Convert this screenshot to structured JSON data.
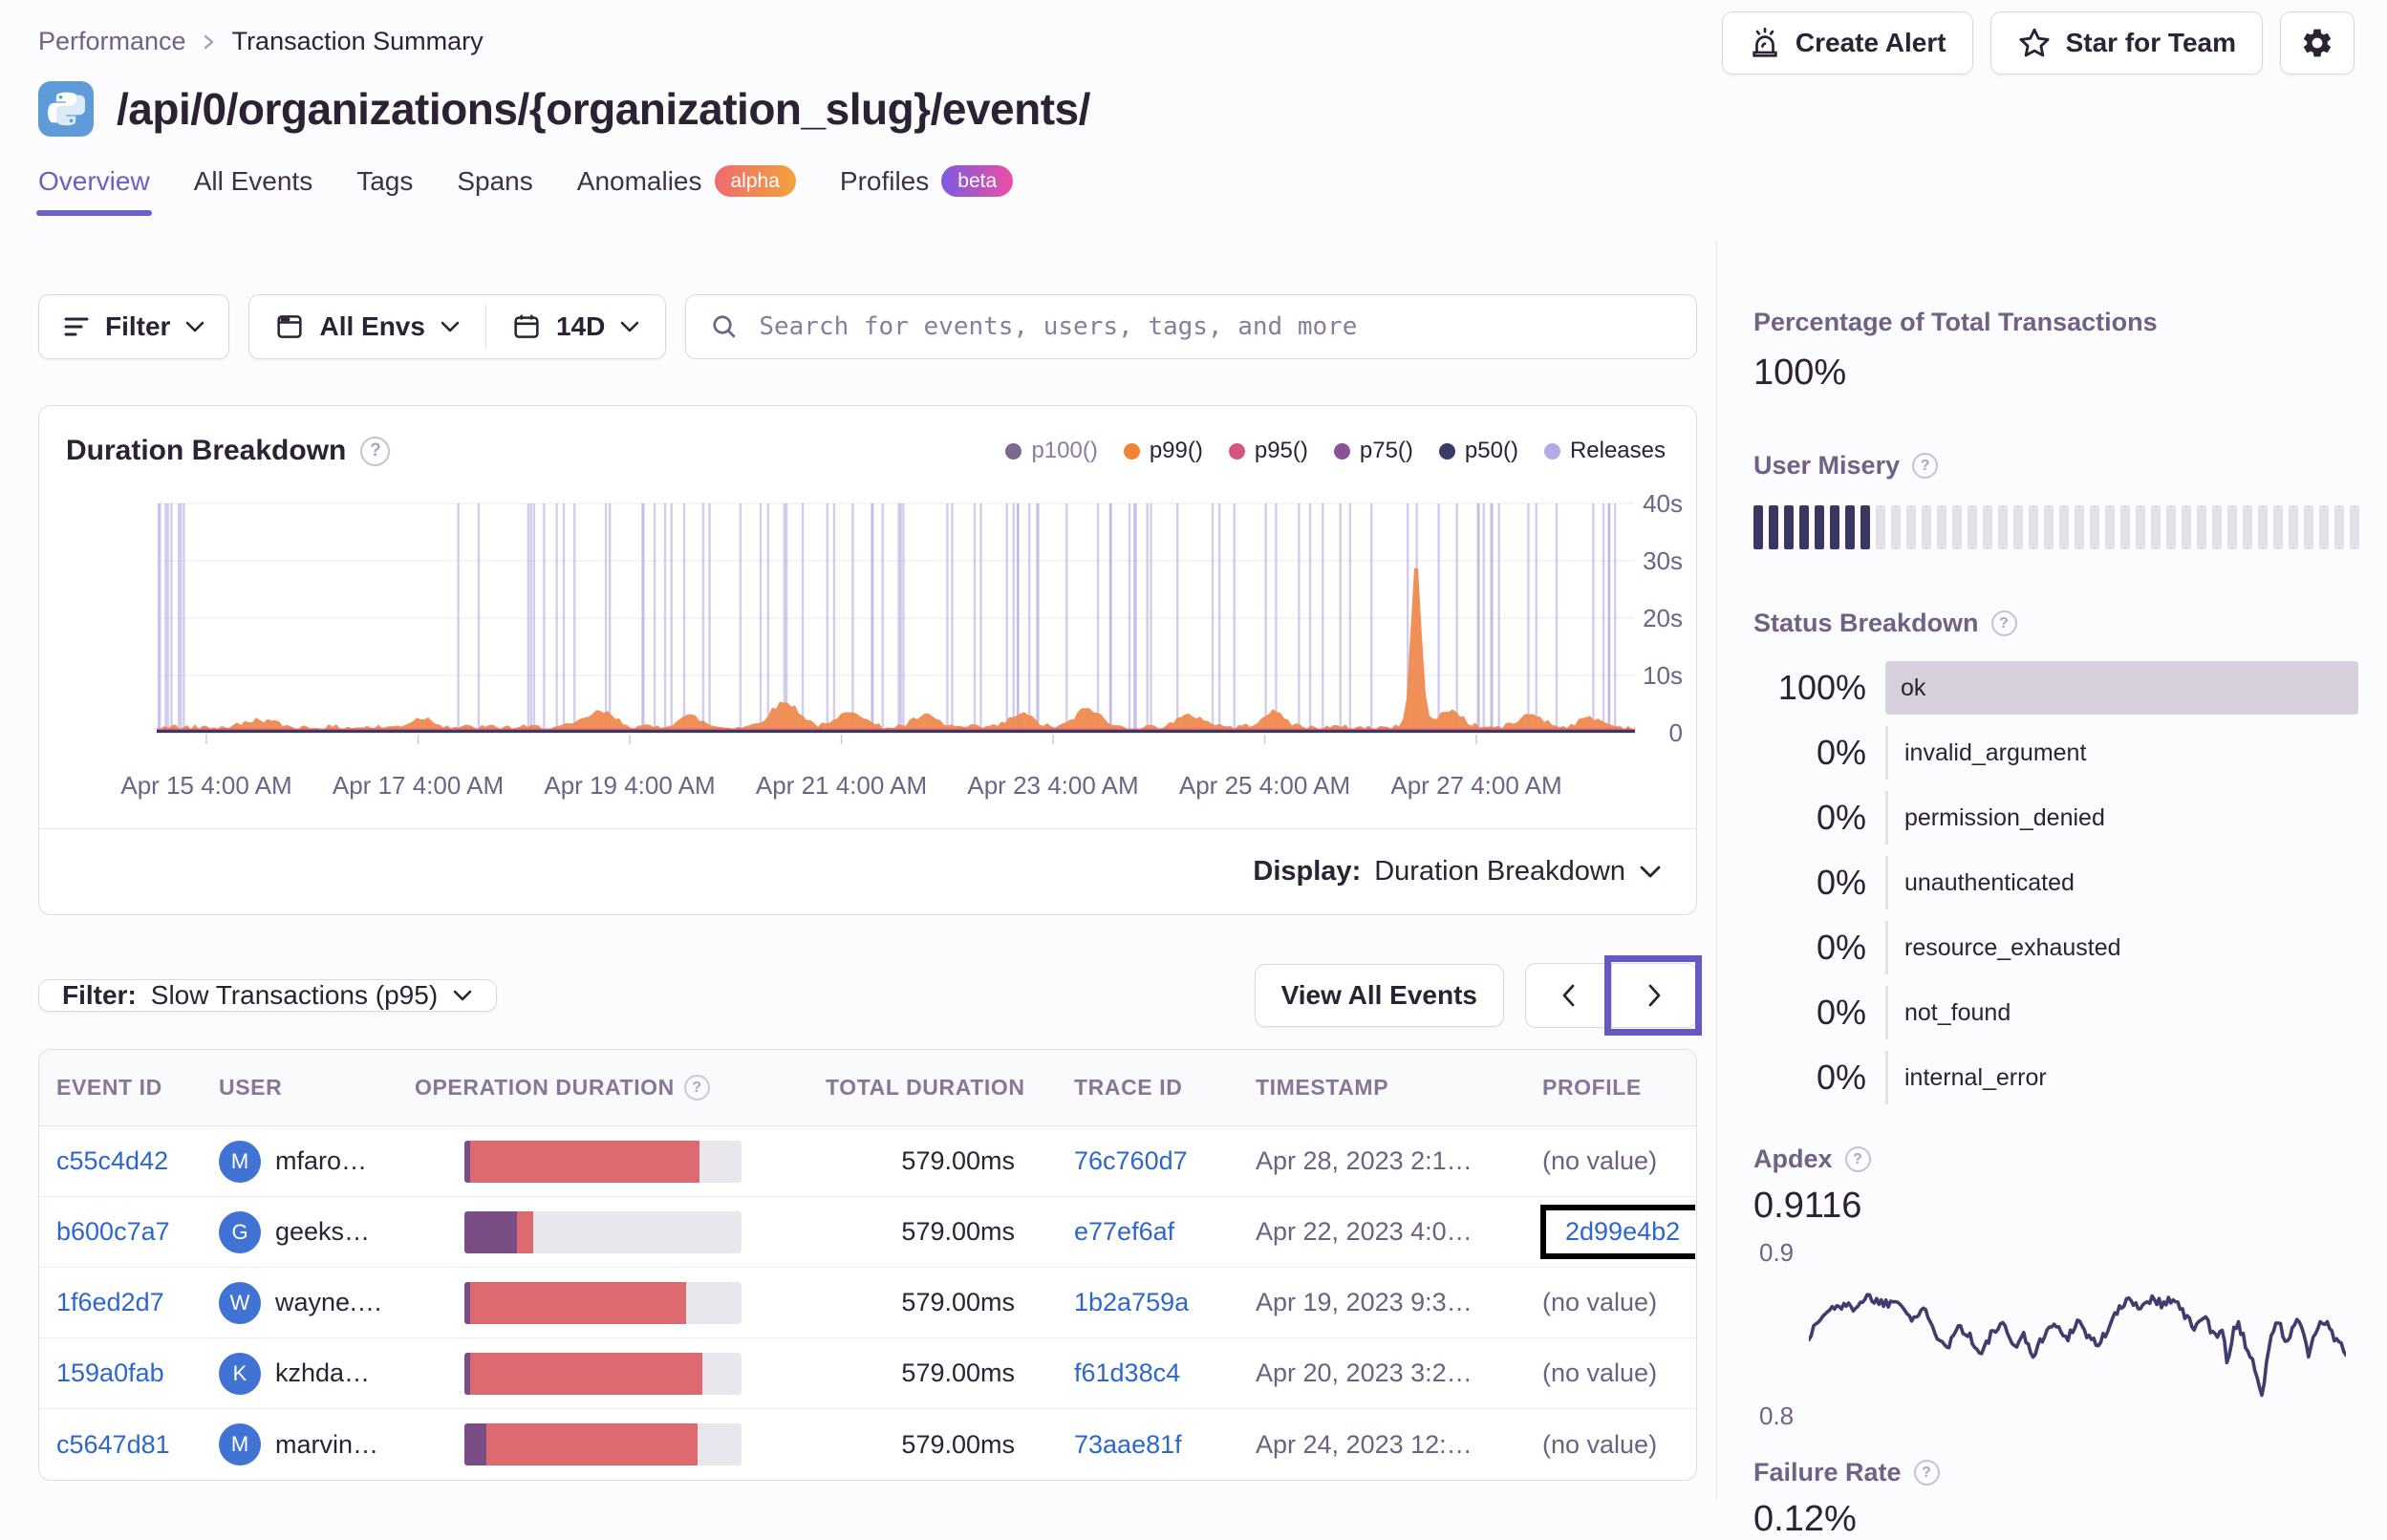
{
  "breadcrumb": {
    "parent": "Performance",
    "current": "Transaction Summary"
  },
  "header": {
    "title": "/api/0/organizations/{organization_slug}/events/",
    "language_icon": "python-icon",
    "create_alert_label": "Create Alert",
    "star_label": "Star for Team"
  },
  "tabs": [
    {
      "label": "Overview",
      "active": true
    },
    {
      "label": "All Events"
    },
    {
      "label": "Tags"
    },
    {
      "label": "Spans"
    },
    {
      "label": "Anomalies",
      "badge": "alpha",
      "badge_colors": [
        "#ee6a70",
        "#f1a33b"
      ]
    },
    {
      "label": "Profiles",
      "badge": "beta",
      "badge_colors": [
        "#7c5ae0",
        "#ec4fa5"
      ]
    }
  ],
  "filter_bar": {
    "filter_label": "Filter",
    "env_label": "All Envs",
    "date_label": "14D",
    "search_placeholder": "Search for events, users, tags, and more"
  },
  "duration_chart": {
    "title": "Duration Breakdown",
    "legend": [
      {
        "label": "p100()",
        "color": "#7b6a8c",
        "muted": true
      },
      {
        "label": "p99()",
        "color": "#ee8435"
      },
      {
        "label": "p95()",
        "color": "#d4567e"
      },
      {
        "label": "p75()",
        "color": "#8b5393"
      },
      {
        "label": "p50()",
        "color": "#3b3a69"
      },
      {
        "label": "Releases",
        "color": "#b4abe4"
      }
    ],
    "yticks": [
      "40s",
      "30s",
      "20s",
      "10s",
      "0"
    ],
    "xticks": [
      "Apr 15 4:00 AM",
      "Apr 17 4:00 AM",
      "Apr 19 4:00 AM",
      "Apr 21 4:00 AM",
      "Apr 23 4:00 AM",
      "Apr 25 4:00 AM",
      "Apr 27 4:00 AM"
    ],
    "display_label": "Display:",
    "display_value": "Duration Breakdown"
  },
  "events_table": {
    "filter_label": "Filter:",
    "filter_value": "Slow Transactions (p95)",
    "view_all_label": "View All Events",
    "columns": [
      {
        "label": "EVENT ID"
      },
      {
        "label": "USER"
      },
      {
        "label": "OPERATION DURATION",
        "help": true
      },
      {
        "label": "TOTAL DURATION"
      },
      {
        "label": "TRACE ID"
      },
      {
        "label": "TIMESTAMP"
      },
      {
        "label": "PROFILE"
      }
    ],
    "rows": [
      {
        "event_id": "c55c4d42",
        "user_initial": "M",
        "user": "mfaro…",
        "op_purple": 2,
        "op_red": 83,
        "total": "579.00ms",
        "trace": "76c760d7",
        "timestamp": "Apr 28, 2023 2:1…",
        "profile": "(no value)",
        "profile_is_link": false,
        "profile_boxed": false
      },
      {
        "event_id": "b600c7a7",
        "user_initial": "G",
        "user": "geeks…",
        "op_purple": 19,
        "op_red": 6,
        "total": "579.00ms",
        "trace": "e77ef6af",
        "timestamp": "Apr 22, 2023 4:0…",
        "profile": "2d99e4b2",
        "profile_is_link": true,
        "profile_boxed": true
      },
      {
        "event_id": "1f6ed2d7",
        "user_initial": "W",
        "user": "wayne.…",
        "op_purple": 2,
        "op_red": 78,
        "total": "579.00ms",
        "trace": "1b2a759a",
        "timestamp": "Apr 19, 2023 9:3…",
        "profile": "(no value)",
        "profile_is_link": false,
        "profile_boxed": false
      },
      {
        "event_id": "159a0fab",
        "user_initial": "K",
        "user": "kzhda…",
        "op_purple": 2,
        "op_red": 84,
        "total": "579.00ms",
        "trace": "f61d38c4",
        "timestamp": "Apr 20, 2023 3:2…",
        "profile": "(no value)",
        "profile_is_link": false,
        "profile_boxed": false
      },
      {
        "event_id": "c5647d81",
        "user_initial": "M",
        "user": "marvin…",
        "op_purple": 8,
        "op_red": 76,
        "total": "579.00ms",
        "trace": "73aae81f",
        "timestamp": "Apr 24, 2023 12:…",
        "profile": "(no value)",
        "profile_is_link": false,
        "profile_boxed": false
      }
    ]
  },
  "sidebar": {
    "total_transactions": {
      "label": "Percentage of Total Transactions",
      "value": "100%"
    },
    "user_misery": {
      "label": "User Misery",
      "filled": 8,
      "total": 40
    },
    "status_breakdown": {
      "label": "Status Breakdown",
      "items": [
        {
          "pct": "100%",
          "status": "ok"
        },
        {
          "pct": "0%",
          "status": "invalid_argument"
        },
        {
          "pct": "0%",
          "status": "permission_denied"
        },
        {
          "pct": "0%",
          "status": "unauthenticated"
        },
        {
          "pct": "0%",
          "status": "resource_exhausted"
        },
        {
          "pct": "0%",
          "status": "not_found"
        },
        {
          "pct": "0%",
          "status": "internal_error"
        }
      ]
    },
    "apdex": {
      "label": "Apdex",
      "value": "0.9116",
      "y_top": "0.9",
      "y_bottom": "0.8"
    },
    "failure_rate": {
      "label": "Failure Rate",
      "value": "0.12%"
    }
  }
}
